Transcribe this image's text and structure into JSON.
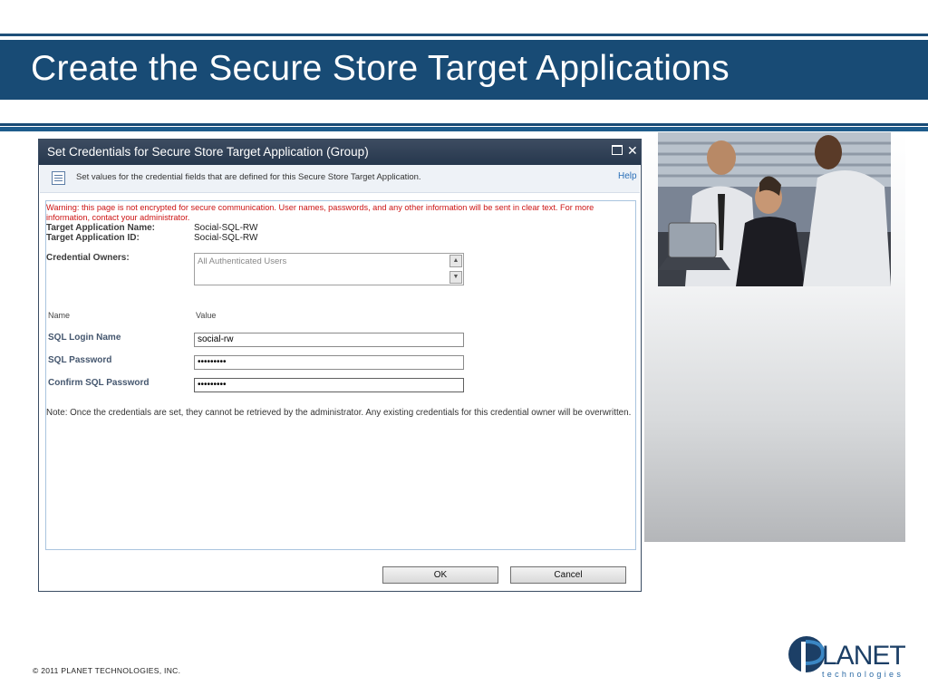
{
  "slide": {
    "title": "Create the Secure Store Target Applications",
    "copyright": "© 2011 PLANET TECHNOLOGIES, INC.",
    "logo": {
      "main": "LANET",
      "sub": "technologies"
    }
  },
  "dialog": {
    "title": "Set Credentials for Secure Store Target Application (Group)",
    "info_text": "Set values for the credential fields that are defined for this Secure Store Target Application.",
    "help": "Help",
    "warning": "Warning: this page is not encrypted for secure communication. User names, passwords, and any other information will be sent in clear text. For more information, contact your administrator.",
    "target_app_name_label": "Target Application Name:",
    "target_app_name_value": "Social-SQL-RW",
    "target_app_id_label": "Target Application ID:",
    "target_app_id_value": "Social-SQL-RW",
    "credential_owners_label": "Credential Owners:",
    "credential_owners_value": "All Authenticated Users",
    "name_header": "Name",
    "value_header": "Value",
    "fields": [
      {
        "label": "SQL Login Name",
        "value": "social-rw"
      },
      {
        "label": "SQL Password",
        "value": "•••••••••"
      },
      {
        "label": "Confirm SQL Password",
        "value": "•••••••••"
      }
    ],
    "note": "Note: Once the credentials are set, they cannot be retrieved by the administrator. Any existing credentials for this credential owner will be overwritten.",
    "ok": "OK",
    "cancel": "Cancel"
  },
  "colors": {
    "title_band": "#184b75",
    "warning": "#cc1414",
    "dialog_titlebar": "#26374d"
  }
}
